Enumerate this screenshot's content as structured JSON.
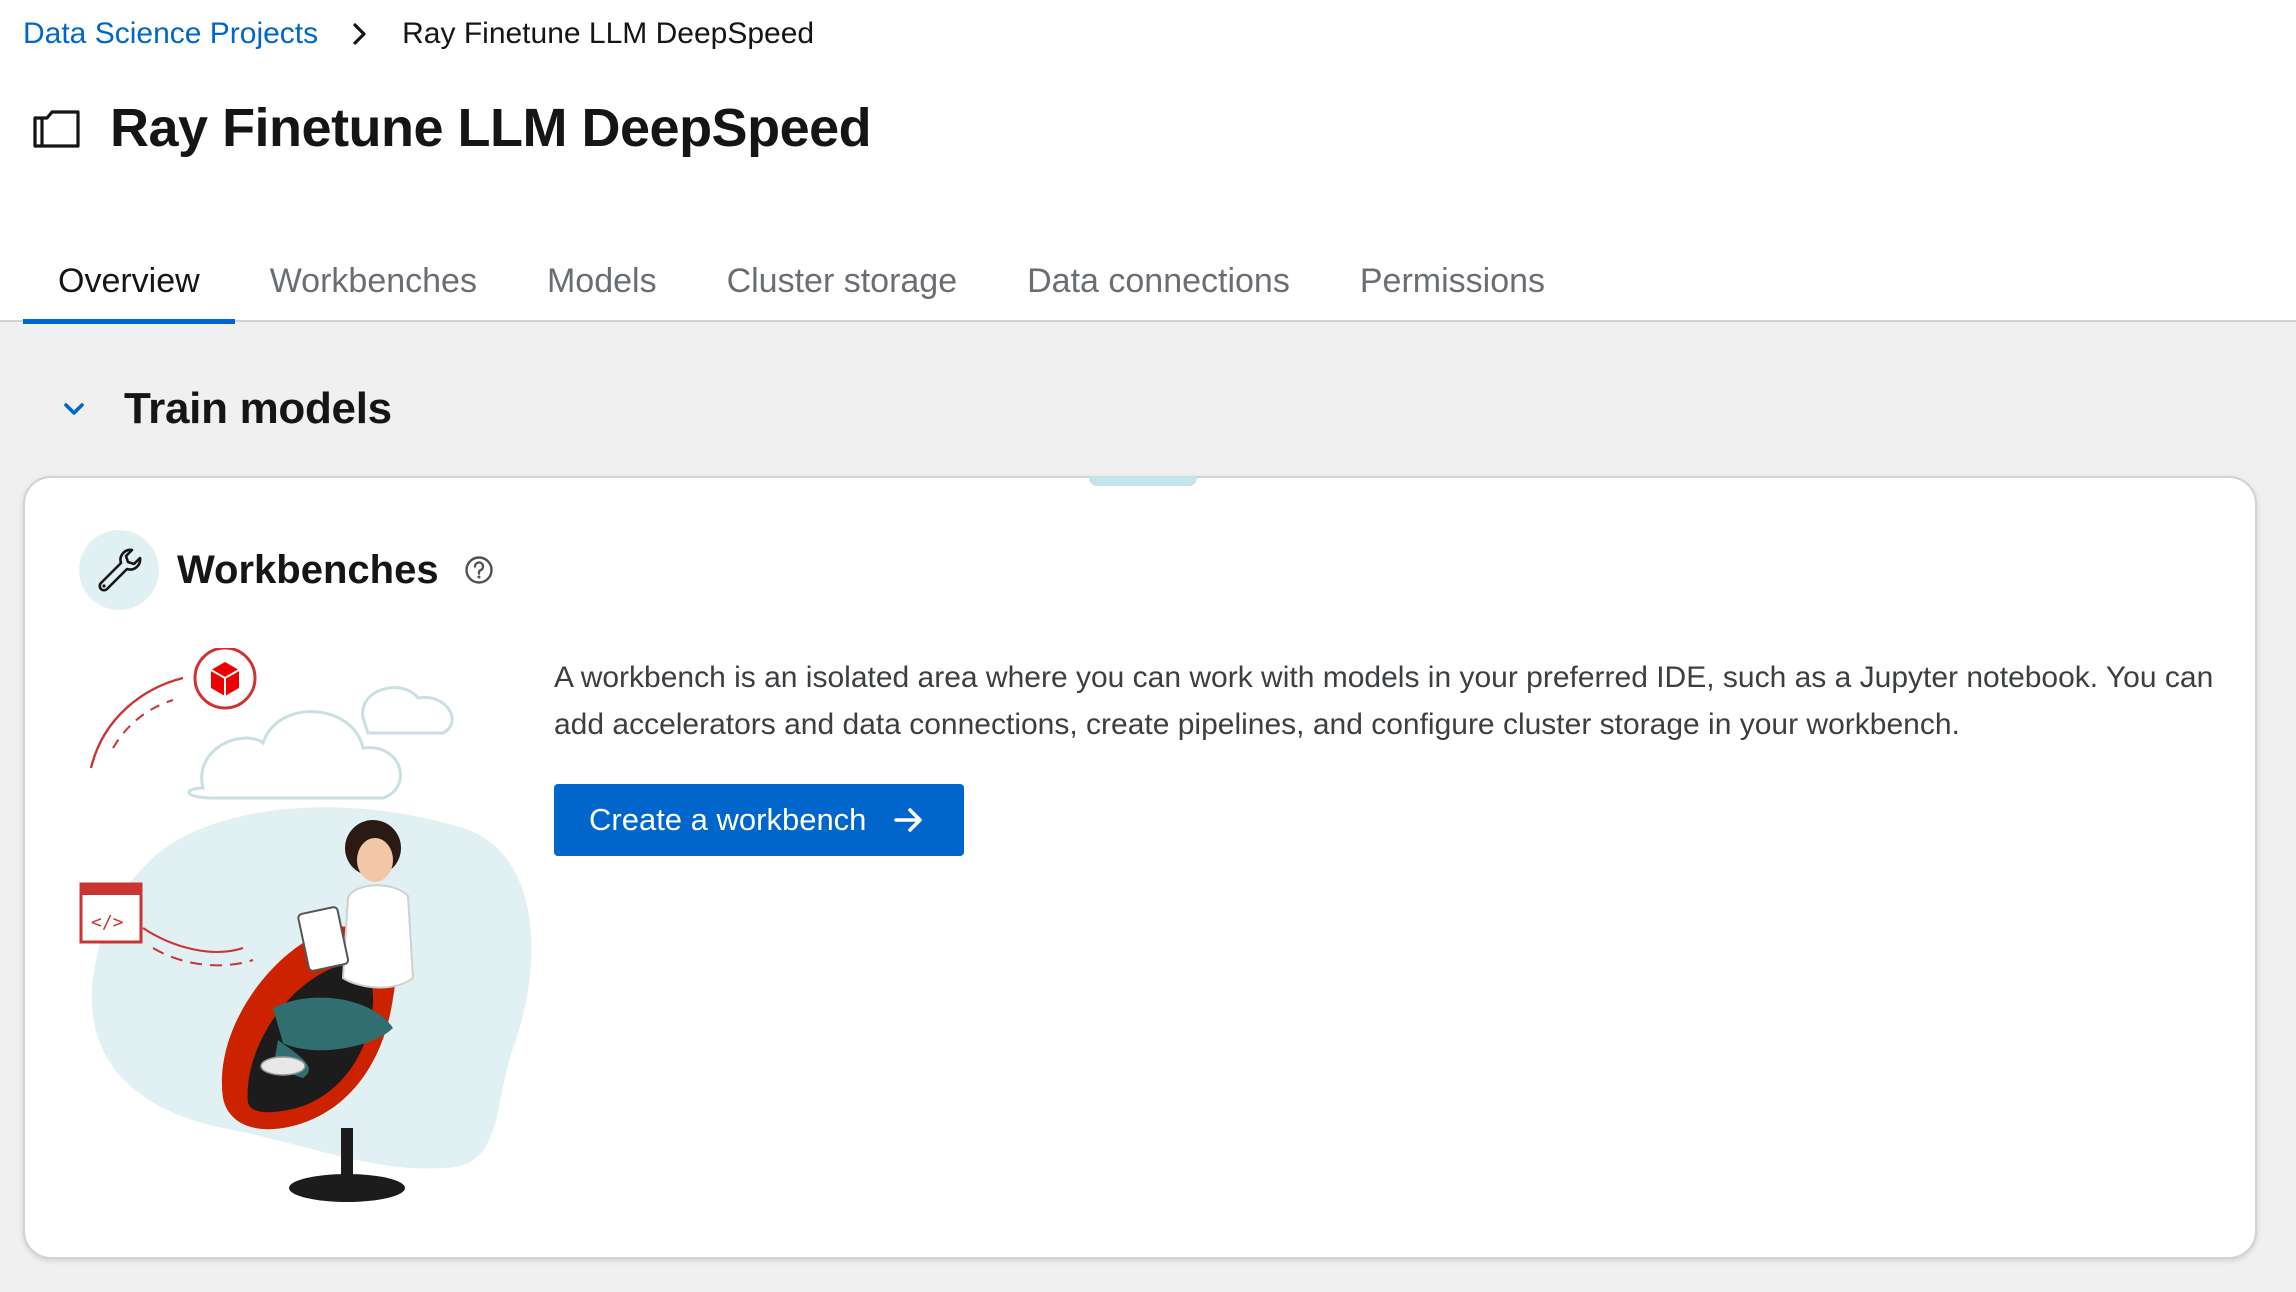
{
  "breadcrumb": {
    "parent": "Data Science Projects",
    "current": "Ray Finetune LLM DeepSpeed"
  },
  "page": {
    "title": "Ray Finetune LLM DeepSpeed",
    "icon": "project-folder-icon"
  },
  "tabs": [
    {
      "label": "Overview",
      "active": true
    },
    {
      "label": "Workbenches",
      "active": false
    },
    {
      "label": "Models",
      "active": false
    },
    {
      "label": "Cluster storage",
      "active": false
    },
    {
      "label": "Data connections",
      "active": false
    },
    {
      "label": "Permissions",
      "active": false
    }
  ],
  "section": {
    "title": "Train models",
    "expanded": true
  },
  "card": {
    "title": "Workbenches",
    "icon": "wrench-icon",
    "help_icon": "help-icon",
    "description": "A workbench is an isolated area where you can work with models in your preferred IDE, such as a Jupyter notebook. You can add accelerators and data connections, create pipelines, and configure cluster storage in your workbench.",
    "button_label": "Create a workbench"
  },
  "colors": {
    "accent": "#0066cc",
    "illustration_red": "#ee0000",
    "illustration_teal": "#e1f1f3"
  }
}
